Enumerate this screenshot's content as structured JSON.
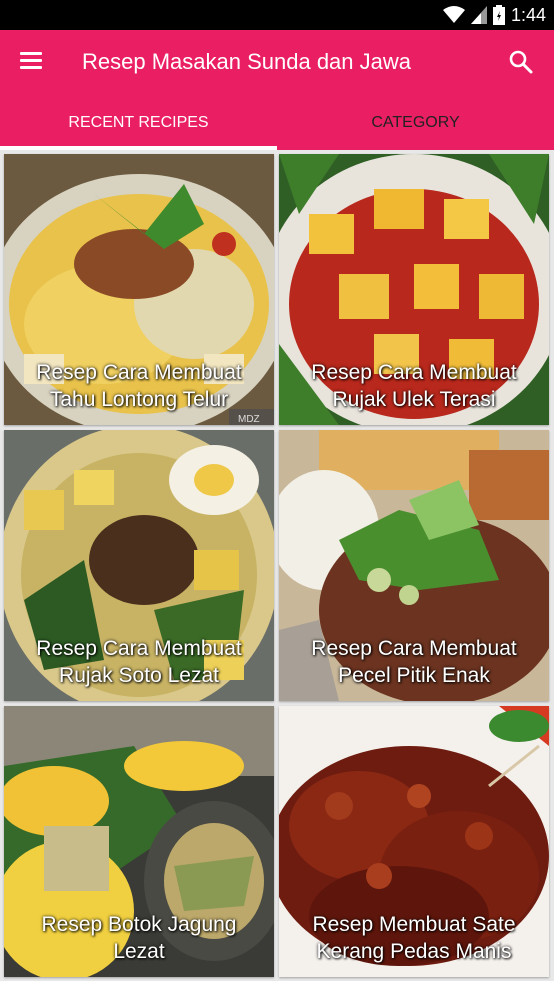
{
  "status_bar": {
    "time": "1:44",
    "icons": [
      "wifi-icon",
      "signal-icon",
      "battery-icon"
    ]
  },
  "app_bar": {
    "title": "Resep Masakan Sunda dan Jawa",
    "menu_icon": "hamburger-menu-icon",
    "search_icon": "search-icon",
    "color": "#ea1e63"
  },
  "tabs": [
    {
      "label": "RECENT RECIPES",
      "selected": true
    },
    {
      "label": "CATEGORY",
      "selected": false
    }
  ],
  "recipes": [
    {
      "line1": "Resep Cara Membuat",
      "line2": "Tahu Lontong Telur",
      "watermark": "MDZ"
    },
    {
      "line1": "Resep Cara Membuat",
      "line2": "Rujak Ulek Terasi"
    },
    {
      "line1": "Resep Cara Membuat",
      "line2": "Rujak Soto Lezat"
    },
    {
      "line1": "Resep Cara Membuat",
      "line2": "Pecel Pitik Enak"
    },
    {
      "line1": "Resep Botok Jagung",
      "line2": "Lezat"
    },
    {
      "line1": "Resep Membuat Sate",
      "line2": "Kerang Pedas Manis"
    }
  ]
}
